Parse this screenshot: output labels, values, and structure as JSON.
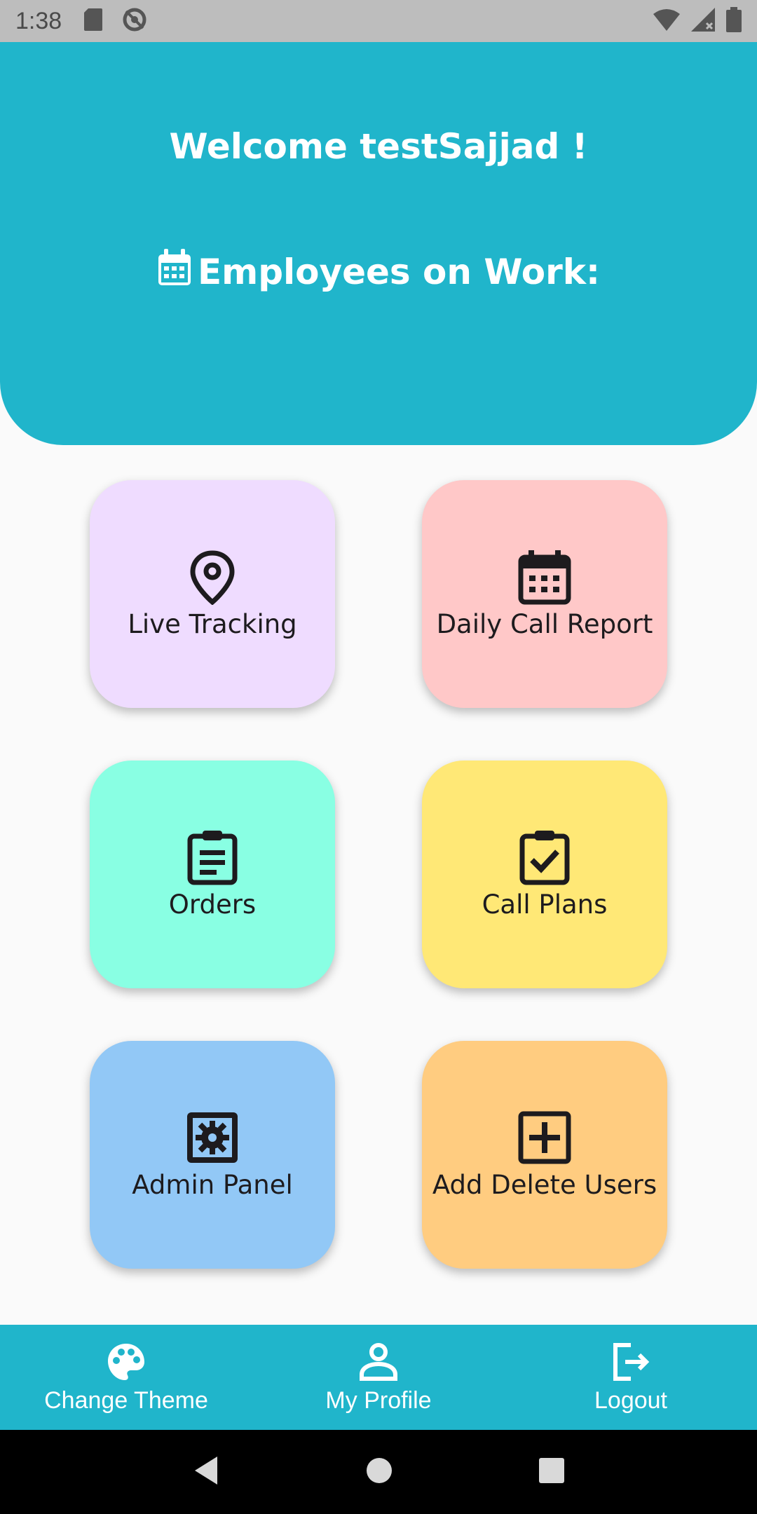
{
  "status_bar": {
    "time": "1:38",
    "icons_left": [
      "sd-card-icon",
      "sync-disabled-icon"
    ],
    "icons_right": [
      "wifi-icon",
      "signal-icon",
      "battery-icon"
    ]
  },
  "header": {
    "welcome_text": "Welcome testSajjad !",
    "employees_text": "Employees on Work:",
    "color": "#20b5cb"
  },
  "cards": [
    {
      "label": "Live Tracking",
      "icon": "location-pin-icon",
      "color": "#efdcff"
    },
    {
      "label": "Daily Call Report",
      "icon": "calendar-icon",
      "color": "#ffc8c8"
    },
    {
      "label": "Orders",
      "icon": "clipboard-list-icon",
      "color": "#89ffe3"
    },
    {
      "label": "Call Plans",
      "icon": "clipboard-check-icon",
      "color": "#ffe876"
    },
    {
      "label": "Admin Panel",
      "icon": "admin-settings-icon",
      "color": "#92c8f6"
    },
    {
      "label": "Add Delete Users",
      "icon": "add-box-icon",
      "color": "#ffcc80"
    }
  ],
  "bottom_nav": [
    {
      "label": "Change Theme",
      "icon": "palette-icon"
    },
    {
      "label": "My Profile",
      "icon": "person-icon"
    },
    {
      "label": "Logout",
      "icon": "logout-icon"
    }
  ],
  "system_nav": [
    "back-icon",
    "home-icon",
    "recents-icon"
  ]
}
